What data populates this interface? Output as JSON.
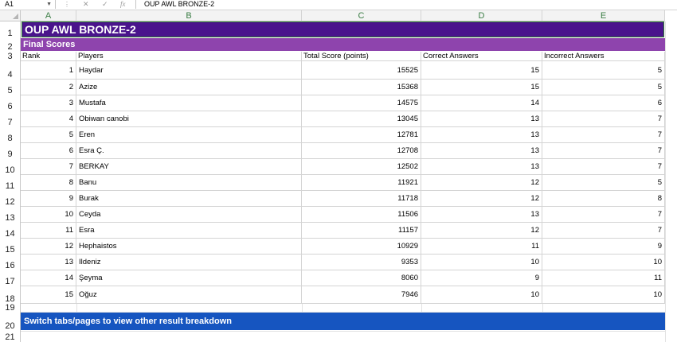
{
  "formula_bar": {
    "name_box": "A1",
    "separator": "⋮",
    "cancel_icon": "✕",
    "enter_icon": "✓",
    "fx_label": "fx",
    "content": "OUP AWL BRONZE-2"
  },
  "columns": [
    "A",
    "B",
    "C",
    "D",
    "E"
  ],
  "rows": [
    "1",
    "2",
    "3",
    "4",
    "5",
    "6",
    "7",
    "8",
    "9",
    "10",
    "11",
    "12",
    "13",
    "14",
    "15",
    "16",
    "17",
    "18",
    "19",
    "20",
    "21"
  ],
  "sheet": {
    "title": "OUP AWL BRONZE-2",
    "subtitle": "Final Scores",
    "headers": [
      "Rank",
      "Players",
      "Total Score (points)",
      "Correct Answers",
      "Incorrect Answers"
    ],
    "data": [
      [
        "1",
        "Haydar",
        "15525",
        "15",
        "5"
      ],
      [
        "2",
        "Azize",
        "15368",
        "15",
        "5"
      ],
      [
        "3",
        "Mustafa",
        "14575",
        "14",
        "6"
      ],
      [
        "4",
        "Obiwan canobi",
        "13045",
        "13",
        "7"
      ],
      [
        "5",
        "Eren",
        "12781",
        "13",
        "7"
      ],
      [
        "6",
        "Esra Ç.",
        "12708",
        "13",
        "7"
      ],
      [
        "7",
        "BERKAY",
        "12502",
        "13",
        "7"
      ],
      [
        "8",
        "Banu",
        "11921",
        "12",
        "5"
      ],
      [
        "9",
        "Burak",
        "11718",
        "12",
        "8"
      ],
      [
        "10",
        "Ceyda",
        "11506",
        "13",
        "7"
      ],
      [
        "11",
        "Esra",
        "11157",
        "12",
        "7"
      ],
      [
        "12",
        "Hephaistos",
        "10929",
        "11",
        "9"
      ],
      [
        "13",
        "Ildeniz",
        "9353",
        "10",
        "10"
      ],
      [
        "14",
        "Şeyma",
        "8060",
        "9",
        "11"
      ],
      [
        "15",
        "Oğuz",
        "7946",
        "10",
        "10"
      ]
    ],
    "footer": "Switch tabs/pages to view other result breakdown"
  },
  "colors": {
    "title_bg": "#4a148c",
    "subtitle_bg": "#8e44ad",
    "footer_bg": "#1655c0",
    "column_header_text": "#3a7d44"
  }
}
